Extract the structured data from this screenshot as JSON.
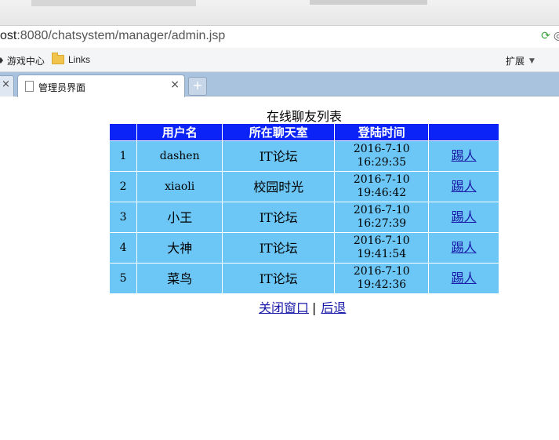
{
  "browser": {
    "url_prefix": "ost",
    "url_rest": ":8080/chatsystem/manager/admin.jsp",
    "bookmarks": [
      {
        "label": "游戏中心",
        "icon": "game-controller-icon"
      },
      {
        "label": "Links",
        "icon": "folder-icon"
      }
    ],
    "extensions_label": "扩展",
    "tab_title": "管理员界面"
  },
  "page": {
    "caption": "在线聊友列表",
    "headers": [
      "",
      "用户名",
      "所在聊天室",
      "登陆时间",
      ""
    ],
    "rows": [
      {
        "no": "1",
        "username": "dashen",
        "room": "IT论坛",
        "date": "2016-7-10",
        "time": "16:29:35",
        "action": "踢人"
      },
      {
        "no": "2",
        "username": "xiaoli",
        "room": "校园时光",
        "date": "2016-7-10",
        "time": "19:46:42",
        "action": "踢人"
      },
      {
        "no": "3",
        "username": "小王",
        "room": "IT论坛",
        "date": "2016-7-10",
        "time": "16:27:39",
        "action": "踢人"
      },
      {
        "no": "4",
        "username": "大神",
        "room": "IT论坛",
        "date": "2016-7-10",
        "time": "19:41:54",
        "action": "踢人"
      },
      {
        "no": "5",
        "username": "菜鸟",
        "room": "IT论坛",
        "date": "2016-7-10",
        "time": "19:42:36",
        "action": "踢人"
      }
    ],
    "close_link": "关闭窗口",
    "separator": "|",
    "back_link": "后退"
  },
  "colors": {
    "header_bg": "#0b23f7",
    "cell_bg": "#6cc7f6",
    "link": "#1a1aa8",
    "tabbar": "#a9c3df"
  }
}
